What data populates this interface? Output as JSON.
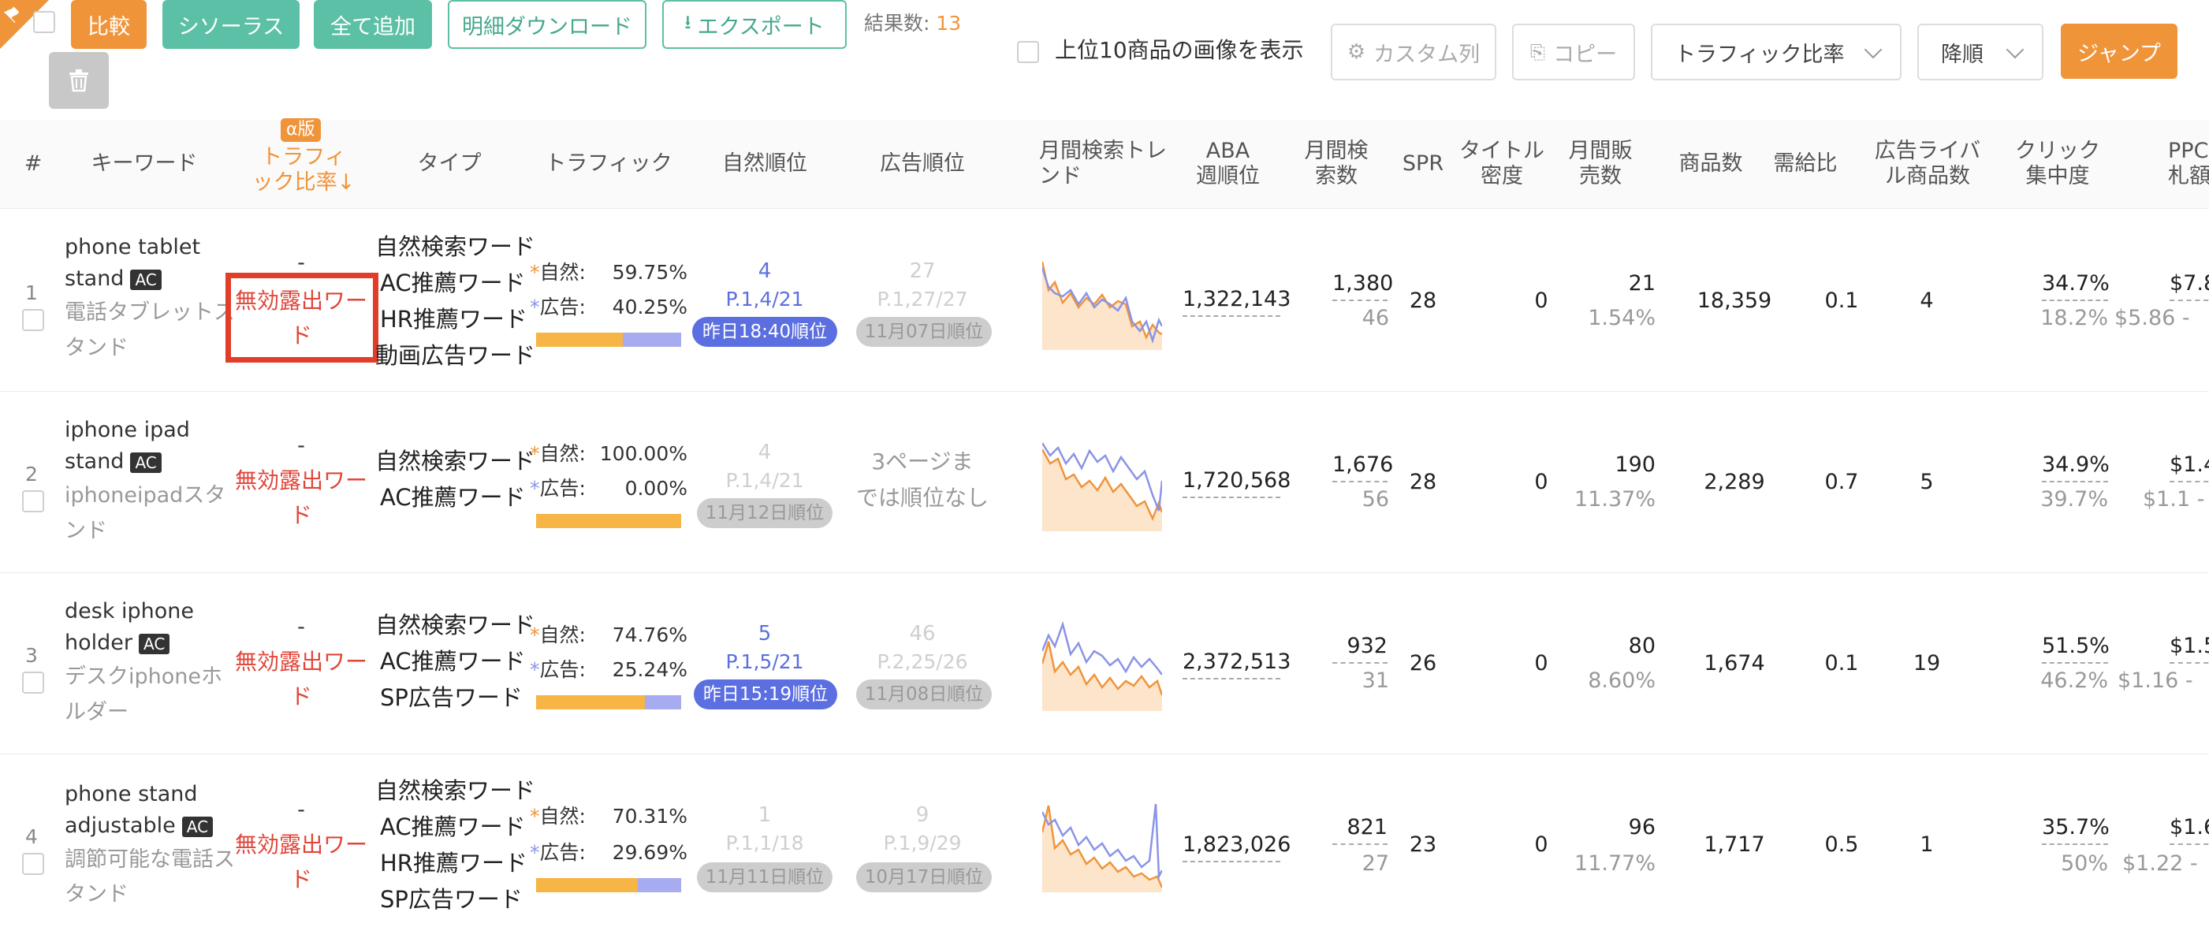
{
  "toolbar": {
    "compare": "比較",
    "thesaurus": "シソーラス",
    "add_all": "全て追加",
    "download_detail": "明細ダウンロード",
    "export": "エクスポート",
    "result_label": "結果数:",
    "result_count": "13",
    "show_images_label": "上位10商品の画像を表示",
    "custom_columns": "カスタム列",
    "copy": "コピー",
    "sort_field": "トラフィック比率",
    "sort_order": "降順",
    "jump": "ジャンプ"
  },
  "header": {
    "index": "#",
    "keyword": "キーワード",
    "beta": "α版",
    "traffic_ratio_1": "トラフィ",
    "traffic_ratio_2": "ック比率↓",
    "type": "タイプ",
    "traffic": "トラフィック",
    "natural_rank": "自然順位",
    "ad_rank": "広告順位",
    "trend_1": "月間検索トレ",
    "trend_2": "ンド",
    "aba_1": "ABA",
    "aba_2": "週順位",
    "monthly_search_1": "月間検",
    "monthly_search_2": "索数",
    "spr": "SPR",
    "title_density_1": "タイトル",
    "title_density_2": "密度",
    "monthly_sales_1": "月間販",
    "monthly_sales_2": "売数",
    "product_count": "商品数",
    "supply_demand": "需給比",
    "ad_rivals_1": "広告ライバ",
    "ad_rivals_2": "ル商品数",
    "click_conc_1": "クリック",
    "click_conc_2": "集中度",
    "ppc_1": "PPC",
    "ppc_2": "札額"
  },
  "rows": [
    {
      "idx": "1",
      "kw_1": "phone tablet",
      "kw_2": "stand",
      "ac": "AC",
      "ja_1": "電話タブレットス",
      "ja_2": "タンド",
      "ratio_dash": "-",
      "ratio_1": "無効露出ワー",
      "ratio_2": "ド",
      "types": [
        "自然検索ワード",
        "AC推薦ワード",
        "HR推薦ワード",
        "動画広告ワード"
      ],
      "nat_label": "自然:",
      "nat_pct": "59.75%",
      "ad_label": "広告:",
      "ad_pct": "40.25%",
      "nat_share": 59.75,
      "nrank_1": "4",
      "nrank_2": "P.1,4/21",
      "nrank_pill": "昨日18:40順位",
      "arank_1": "27",
      "arank_2": "P.1,27/27",
      "arank_pill": "11月07日順位",
      "aba": "1,322,143",
      "ms_1": "1,380",
      "ms_2": "46",
      "spr": "28",
      "td": "0",
      "sales_1": "21",
      "sales_2": "1.54%",
      "products": "18,359",
      "sd": "0.1",
      "rivals": "4",
      "click_1": "34.7%",
      "click_2": "18.2%",
      "ppc_1": "$7.8",
      "ppc_2": "$5.86 -"
    },
    {
      "idx": "2",
      "kw_1": "iphone ipad",
      "kw_2": "stand",
      "ac": "AC",
      "ja_1": "iphoneipadスタ",
      "ja_2": "ンド",
      "ratio_dash": "-",
      "ratio_1": "無効露出ワー",
      "ratio_2": "ド",
      "types": [
        "自然検索ワード",
        "AC推薦ワード"
      ],
      "nat_label": "自然:",
      "nat_pct": "100.00%",
      "ad_label": "広告:",
      "ad_pct": "0.00%",
      "nat_share": 100,
      "nrank_1": "4",
      "nrank_2": "P.1,4/21",
      "nrank_pill": "11月12日順位",
      "arank_1": "3ページま",
      "arank_2": "では順位なし",
      "aba": "1,720,568",
      "ms_1": "1,676",
      "ms_2": "56",
      "spr": "28",
      "td": "0",
      "sales_1": "190",
      "sales_2": "11.37%",
      "products": "2,289",
      "sd": "0.7",
      "rivals": "5",
      "click_1": "34.9%",
      "click_2": "39.7%",
      "ppc_1": "$1.4",
      "ppc_2": "$1.1 -"
    },
    {
      "idx": "3",
      "kw_1": "desk iphone",
      "kw_2": "holder",
      "ac": "AC",
      "ja_1": "デスクiphoneホ",
      "ja_2": "ルダー",
      "ratio_dash": "-",
      "ratio_1": "無効露出ワー",
      "ratio_2": "ド",
      "types": [
        "自然検索ワード",
        "AC推薦ワード",
        "SP広告ワード"
      ],
      "nat_label": "自然:",
      "nat_pct": "74.76%",
      "ad_label": "広告:",
      "ad_pct": "25.24%",
      "nat_share": 74.76,
      "nrank_1": "5",
      "nrank_2": "P.1,5/21",
      "nrank_pill": "昨日15:19順位",
      "arank_1": "46",
      "arank_2": "P.2,25/26",
      "arank_pill": "11月08日順位",
      "aba": "2,372,513",
      "ms_1": "932",
      "ms_2": "31",
      "spr": "26",
      "td": "0",
      "sales_1": "80",
      "sales_2": "8.60%",
      "products": "1,674",
      "sd": "0.1",
      "rivals": "19",
      "click_1": "51.5%",
      "click_2": "46.2%",
      "ppc_1": "$1.5",
      "ppc_2": "$1.16 -"
    },
    {
      "idx": "4",
      "kw_1": "phone stand",
      "kw_2": "adjustable",
      "ac": "AC",
      "ja_1": "調節可能な電話ス",
      "ja_2": "タンド",
      "ratio_dash": "-",
      "ratio_1": "無効露出ワー",
      "ratio_2": "ド",
      "types": [
        "自然検索ワード",
        "AC推薦ワード",
        "HR推薦ワード",
        "SP広告ワード"
      ],
      "nat_label": "自然:",
      "nat_pct": "70.31%",
      "ad_label": "広告:",
      "ad_pct": "29.69%",
      "nat_share": 70.31,
      "nrank_1": "1",
      "nrank_2": "P.1,1/18",
      "nrank_pill": "11月11日順位",
      "arank_1": "9",
      "arank_2": "P.1,9/29",
      "arank_pill": "10月17日順位",
      "aba": "1,823,026",
      "ms_1": "821",
      "ms_2": "27",
      "spr": "23",
      "td": "0",
      "sales_1": "96",
      "sales_2": "11.77%",
      "products": "1,717",
      "sd": "0.5",
      "rivals": "1",
      "click_1": "35.7%",
      "click_2": "50%",
      "ppc_1": "$1.6",
      "ppc_2": "$1.22 -"
    }
  ],
  "colors": {
    "accent_orange": "#f0943a",
    "green": "#5cc0a6",
    "blue": "#5b6fe0",
    "red": "#e0463a"
  }
}
